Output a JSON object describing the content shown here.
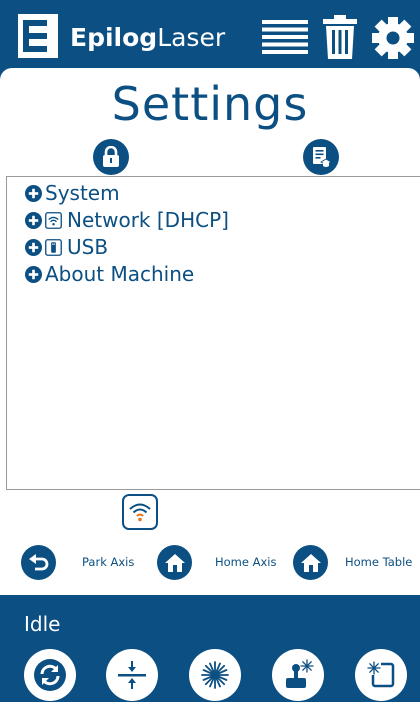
{
  "header": {
    "brand_bold": "Epilog",
    "brand_light": "Laser",
    "icons": [
      "epilog-logo-icon",
      "job-list-icon",
      "trash-icon",
      "gear-icon"
    ]
  },
  "page": {
    "title": "Settings"
  },
  "top_buttons": {
    "left_icon": "lock-icon",
    "right_icon": "certificate-document-icon"
  },
  "tree": {
    "items": [
      {
        "label": "System",
        "icon": "plus-circle-icon"
      },
      {
        "label": "Network [DHCP]",
        "icon": "plus-circle-icon",
        "sub_icon": "wifi-icon"
      },
      {
        "label": "USB",
        "icon": "plus-circle-icon",
        "sub_icon": "usb-drive-icon"
      },
      {
        "label": "About Machine",
        "icon": "plus-circle-icon"
      }
    ]
  },
  "connection": {
    "icon": "wifi-signal-icon",
    "accent": "#e8731c"
  },
  "axis_controls": {
    "park_axis": "Park Axis",
    "home_axis": "Home Axis",
    "home_table": "Home Table"
  },
  "status": {
    "text": "Idle"
  },
  "bottom_bar": {
    "buttons": [
      "refresh-icon",
      "focus-icon",
      "laser-fire-icon",
      "jog-joystick-icon",
      "frame-trace-icon"
    ]
  },
  "colors": {
    "brand_blue": "#0c4f82",
    "white": "#ffffff",
    "orange": "#e8731c"
  }
}
